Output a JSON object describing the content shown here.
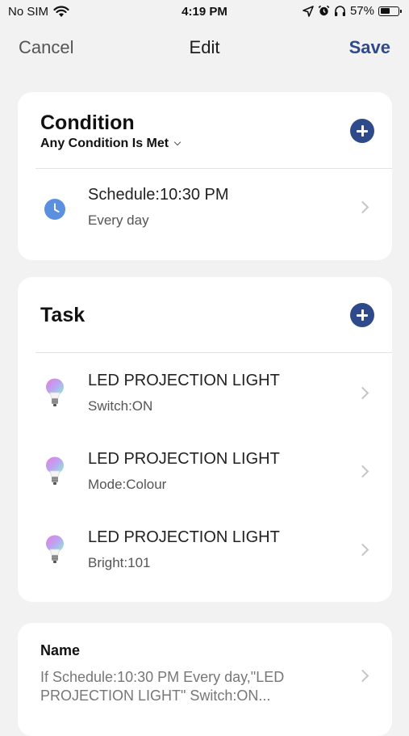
{
  "status_bar": {
    "carrier": "No SIM",
    "time": "4:19 PM",
    "battery": "57%",
    "battery_level": 0.57,
    "icons": [
      "wifi-icon",
      "location-arrow-icon",
      "alarm-icon",
      "headphones-icon",
      "battery-icon"
    ]
  },
  "nav": {
    "cancel": "Cancel",
    "title": "Edit",
    "save": "Save"
  },
  "condition": {
    "title": "Condition",
    "match": "Any Condition Is Met",
    "items": [
      {
        "title": "Schedule:10:30 PM",
        "subtitle": "Every day",
        "icon": "clock-icon"
      }
    ]
  },
  "task": {
    "title": "Task",
    "items": [
      {
        "title": "LED PROJECTION LIGHT",
        "subtitle": "Switch:ON",
        "icon": "bulb-icon"
      },
      {
        "title": "LED PROJECTION LIGHT",
        "subtitle": "Mode:Colour",
        "icon": "bulb-icon"
      },
      {
        "title": "LED PROJECTION LIGHT",
        "subtitle": "Bright:101",
        "icon": "bulb-icon"
      }
    ]
  },
  "name": {
    "label": "Name",
    "value": "If Schedule:10:30 PM Every day,\"LED PROJECTION LIGHT\" Switch:ON..."
  },
  "colors": {
    "background": "#f2f2f2",
    "card": "#ffffff",
    "accent": "#2f4a8a",
    "clock": "#5b8fe0"
  }
}
